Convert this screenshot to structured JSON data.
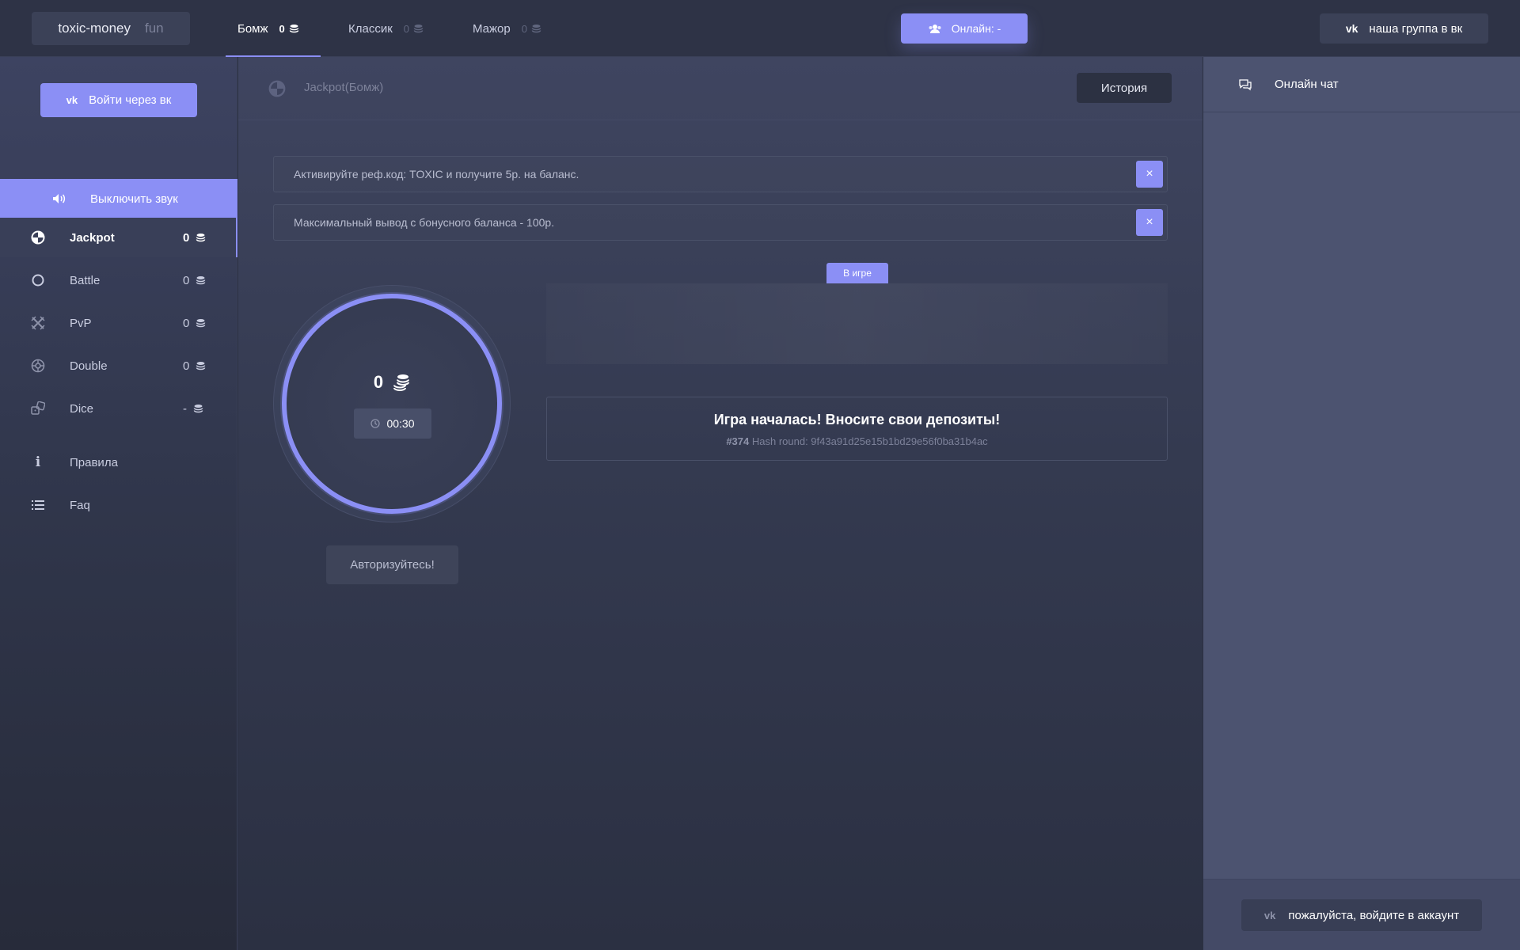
{
  "logo": {
    "main": "toxic-money",
    "suffix": "fun"
  },
  "game_tabs": [
    {
      "label": "Бомж",
      "count": "0"
    },
    {
      "label": "Классик",
      "count": "0"
    },
    {
      "label": "Мажор",
      "count": "0"
    }
  ],
  "online_button": {
    "label": "Онлайн: -",
    "icon": "users-icon"
  },
  "vk_group_button": {
    "label": "наша группа в вк",
    "icon": "vk-icon"
  },
  "sidebar": {
    "login_button": "Войти через вк",
    "sound_toggle": "Выключить звук",
    "items": [
      {
        "label": "Jackpot",
        "value": "0",
        "icon": "jackpot-icon"
      },
      {
        "label": "Battle",
        "value": "0",
        "icon": "circle-icon"
      },
      {
        "label": "PvP",
        "value": "0",
        "icon": "swords-icon"
      },
      {
        "label": "Double",
        "value": "0",
        "icon": "roulette-icon"
      },
      {
        "label": "Dice",
        "value": "-",
        "icon": "dice-icon"
      },
      {
        "label": "Правила",
        "icon": "info-icon"
      },
      {
        "label": "Faq",
        "icon": "list-icon"
      }
    ]
  },
  "main": {
    "title": "Jackpot(Бомж)",
    "history_button": "История",
    "notices": [
      {
        "text": "Активируйте реф.код: TOXIC и получите 5р. на баланс.",
        "close": "×"
      },
      {
        "text": "Максимальный вывод с бонусного баланса - 100р.",
        "close": "×"
      }
    ],
    "in_game_tag": "В игре",
    "bank_value": "0",
    "timer": "00:30",
    "auth_button": "Авторизуйтесь!",
    "game_status": "Игра началась! Вносите свои депозиты!",
    "round_number": "#374",
    "hash_text": "Hash round: 9f43a91d25e15b1bd29e56f0ba31b4ac"
  },
  "chat": {
    "title": "Онлайн чат",
    "login_prompt": "пожалуйста, войдите в аккаунт"
  },
  "colors": {
    "accent": "#8b8ff5",
    "background": "#2b3042",
    "chat_bg": "#4c5370"
  }
}
